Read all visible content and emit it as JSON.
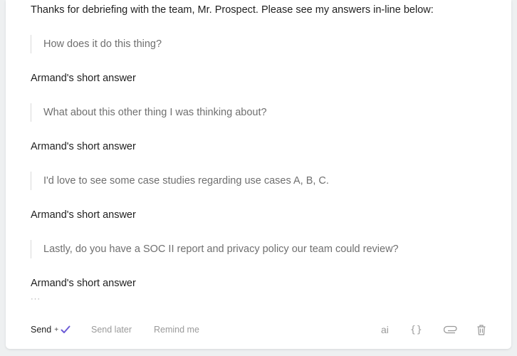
{
  "message": {
    "intro": "Thanks for debriefing with the team, Mr. Prospect. Please see my answers in-line below:",
    "qa": [
      {
        "question": "How does it do this thing?",
        "answer": "Armand's short answer"
      },
      {
        "question": "What about this other thing I was thinking about?",
        "answer": "Armand's short answer"
      },
      {
        "question": "I'd love to see some case studies regarding use cases A, B, C.",
        "answer": "Armand's short answer"
      },
      {
        "question": "Lastly, do you have a SOC II report and privacy policy our team could review?",
        "answer": "Armand's short answer"
      }
    ],
    "ellipsis": "···"
  },
  "footer": {
    "send_label": "Send",
    "send_plus": "+",
    "send_later_label": "Send later",
    "remind_me_label": "Remind me",
    "ai_label": "ai",
    "code_label": "{}"
  },
  "icons": {
    "check": "check-icon",
    "attach": "paperclip-icon",
    "trash": "trash-icon"
  },
  "colors": {
    "accent": "#6b5bd6",
    "text": "#1f1f1f",
    "muted": "#9a9a9a",
    "quote_text": "#6f6f6f"
  }
}
